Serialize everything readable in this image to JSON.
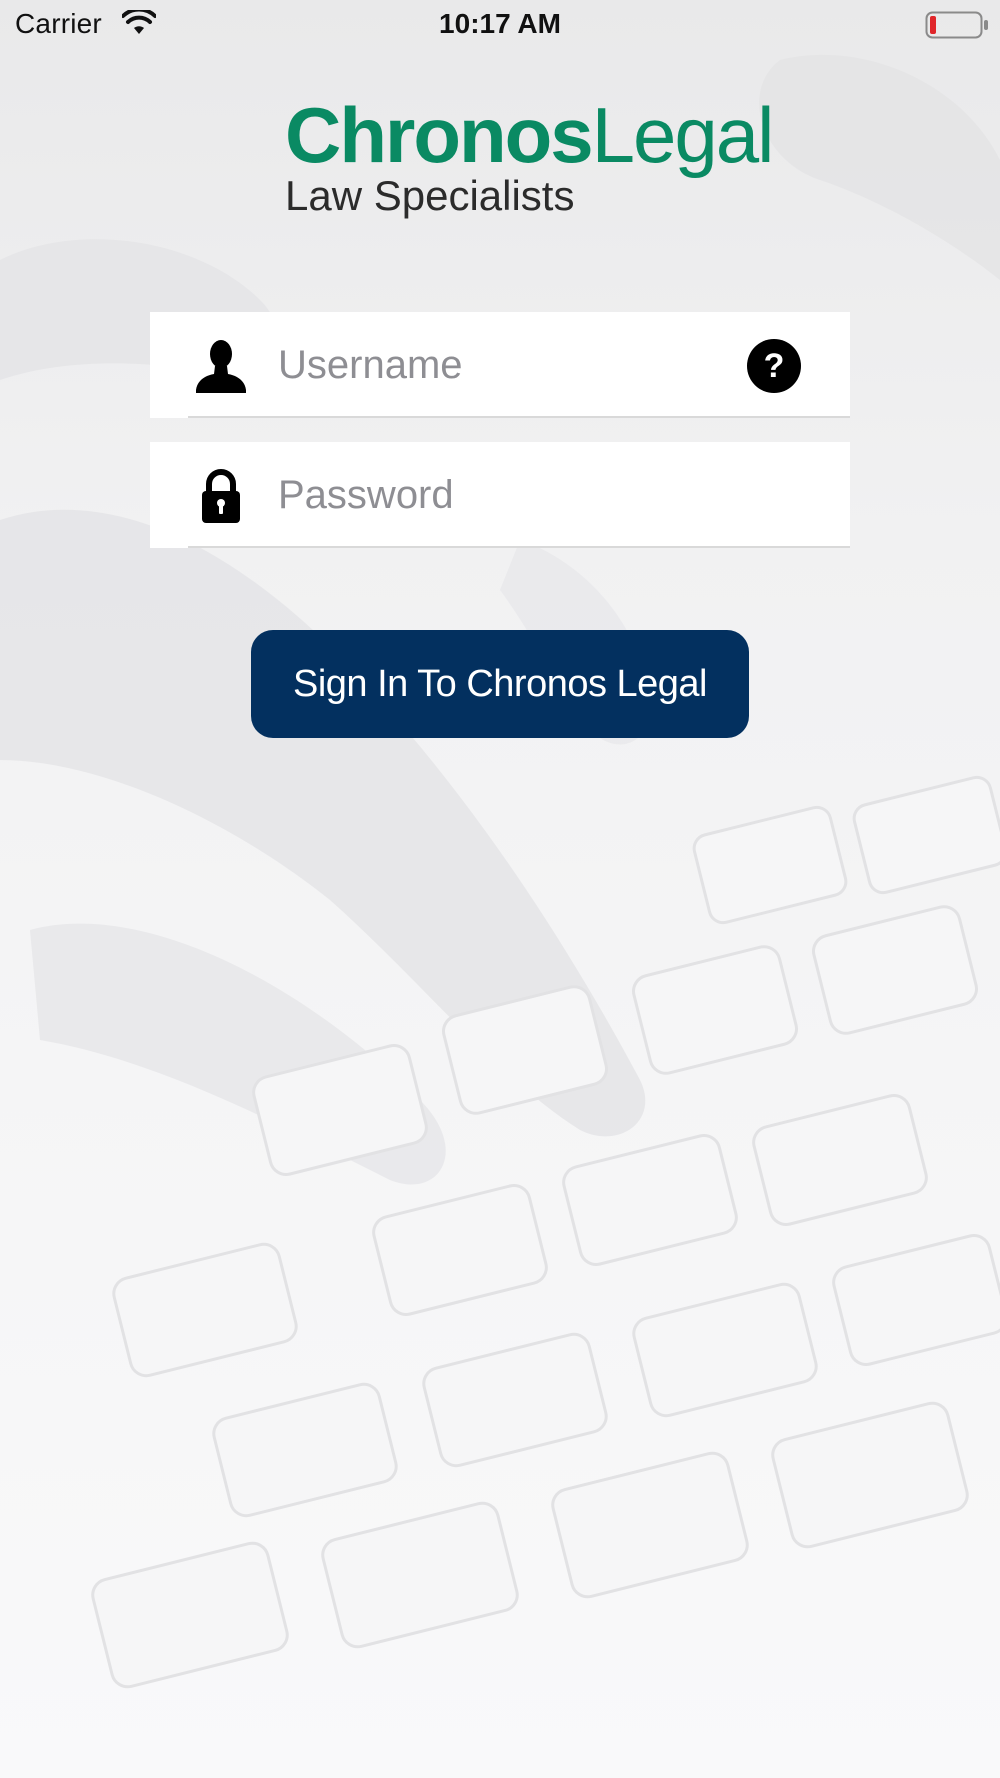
{
  "status_bar": {
    "carrier": "Carrier",
    "time": "10:17 AM",
    "wifi_icon": "wifi-icon",
    "battery_icon": "battery-low-icon"
  },
  "logo": {
    "name_strong": "Chronos",
    "name_light": "Legal",
    "tagline": "Law Specialists",
    "colors": {
      "brand_green": "#0a8a63",
      "tagline": "#2b2b2b"
    }
  },
  "login_form": {
    "username": {
      "placeholder": "Username",
      "value": "",
      "icon": "user-icon",
      "help_icon": "help-icon",
      "help_glyph": "?"
    },
    "password": {
      "placeholder": "Password",
      "value": "",
      "icon": "lock-icon"
    },
    "sign_in_label": "Sign In To Chronos Legal"
  },
  "colors": {
    "sign_in_button": "#03305f",
    "battery_level": "#e0262a"
  }
}
